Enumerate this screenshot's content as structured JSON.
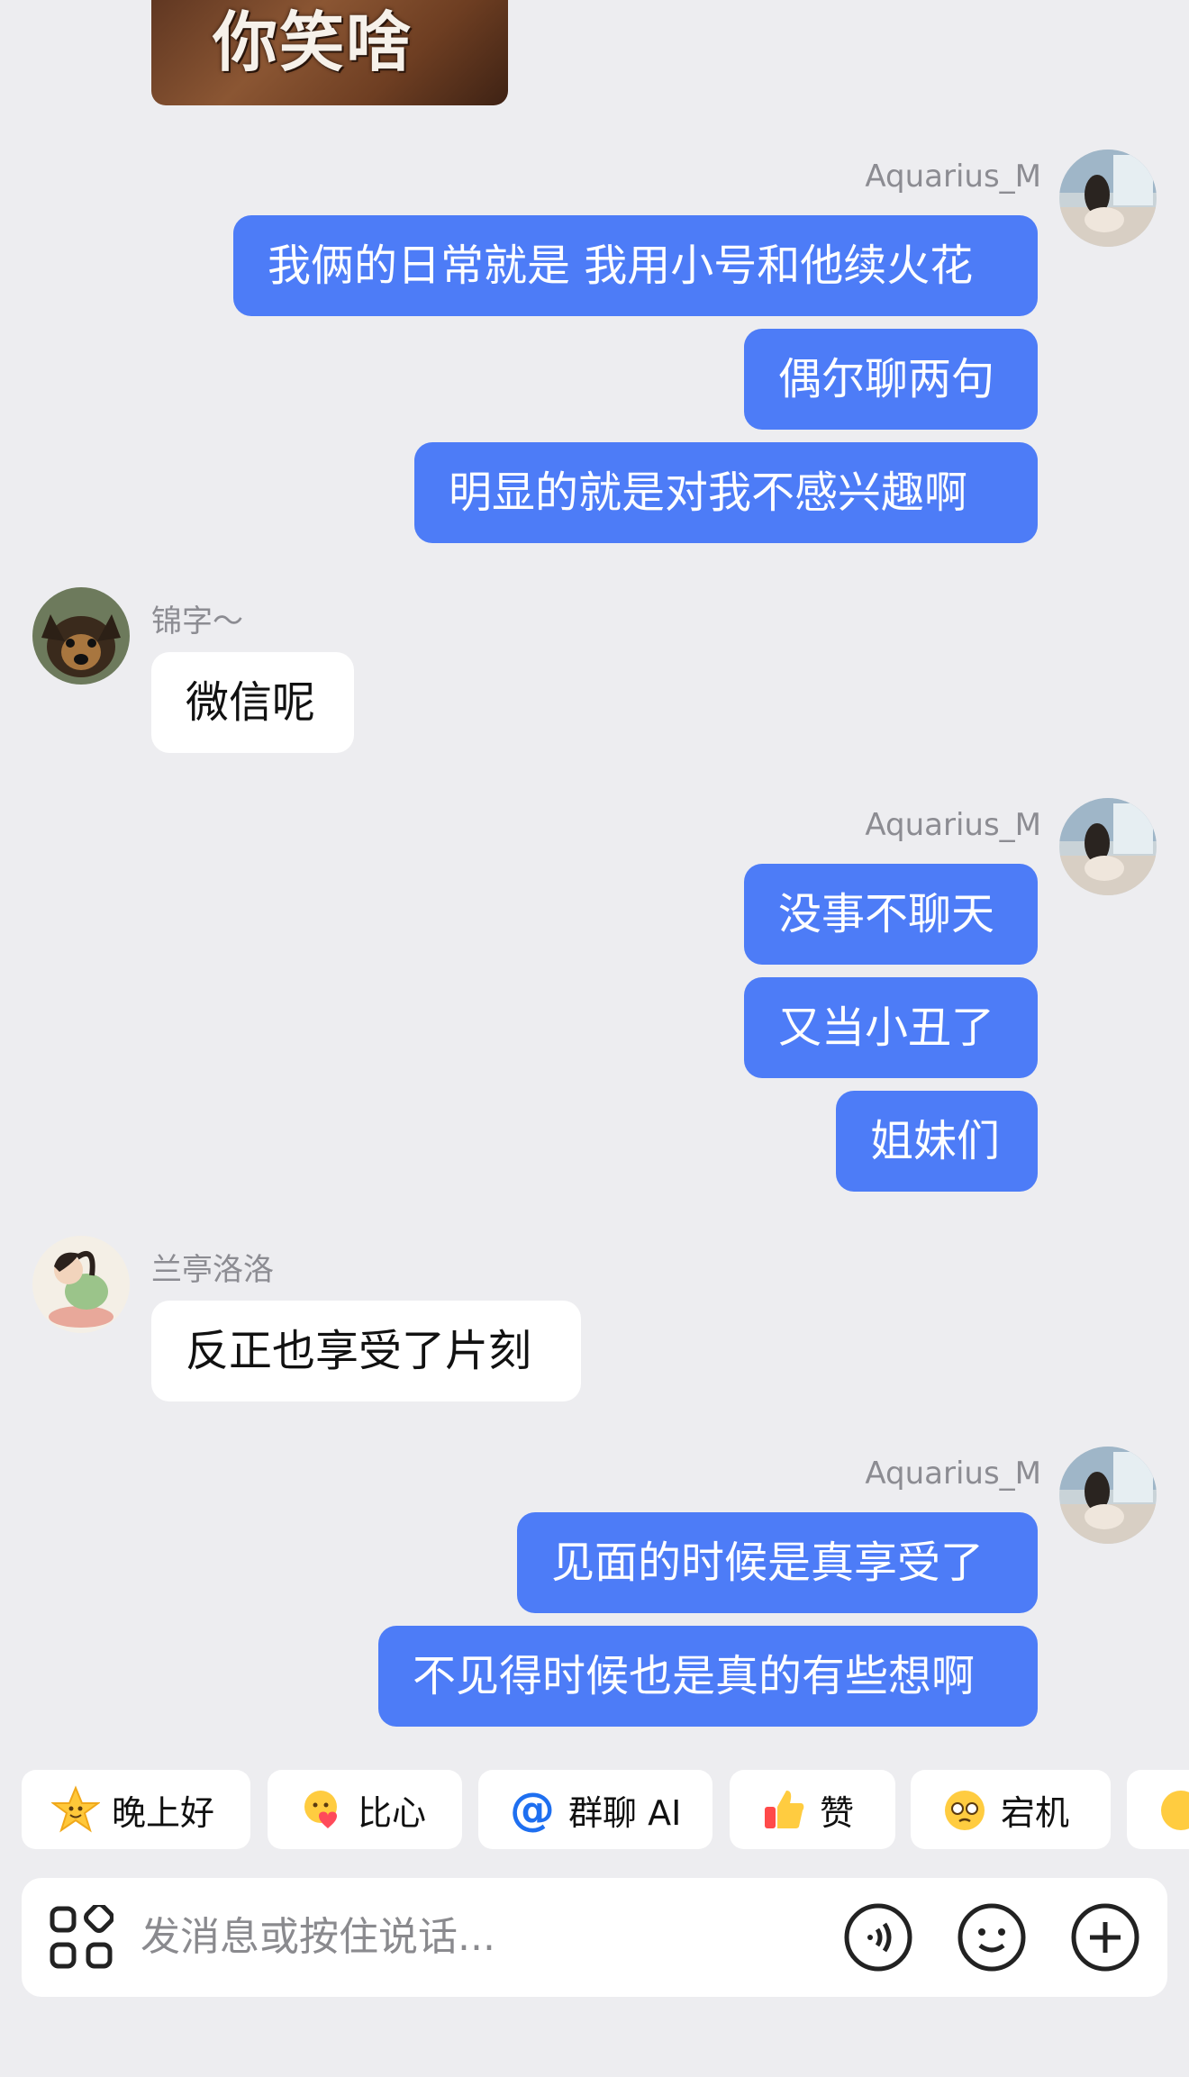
{
  "sticker": {
    "text": "你笑啥"
  },
  "messages": {
    "g1": {
      "sender": "Aquarius_M",
      "bubbles": [
        "我俩的日常就是 我用小号和他续火花",
        "偶尔聊两句",
        "明显的就是对我不感兴趣啊"
      ]
    },
    "g2": {
      "sender": "锦字～",
      "bubbles": [
        "微信呢"
      ]
    },
    "g3": {
      "sender": "Aquarius_M",
      "bubbles": [
        "没事不聊天",
        "又当小丑了",
        "姐妹们"
      ]
    },
    "g4": {
      "sender": "兰亭洛洛",
      "bubbles": [
        "反正也享受了片刻"
      ]
    },
    "g5": {
      "sender": "Aquarius_M",
      "bubbles": [
        "见面的时候是真享受了",
        "不见得时候也是真的有些想啊"
      ]
    }
  },
  "quick_replies": [
    {
      "label": "晚上好",
      "icon": "star-face-icon"
    },
    {
      "label": "比心",
      "icon": "heart-hands-icon"
    },
    {
      "label": "群聊 AI",
      "icon": "at-icon"
    },
    {
      "label": "赞",
      "icon": "thumbs-up-icon"
    },
    {
      "label": "宕机",
      "icon": "dizzy-face-icon"
    }
  ],
  "input": {
    "placeholder": "发消息或按住说话..."
  },
  "colors": {
    "my_bubble": "#4d7cf7",
    "background": "#ededf0",
    "other_bubble": "#ffffff"
  }
}
